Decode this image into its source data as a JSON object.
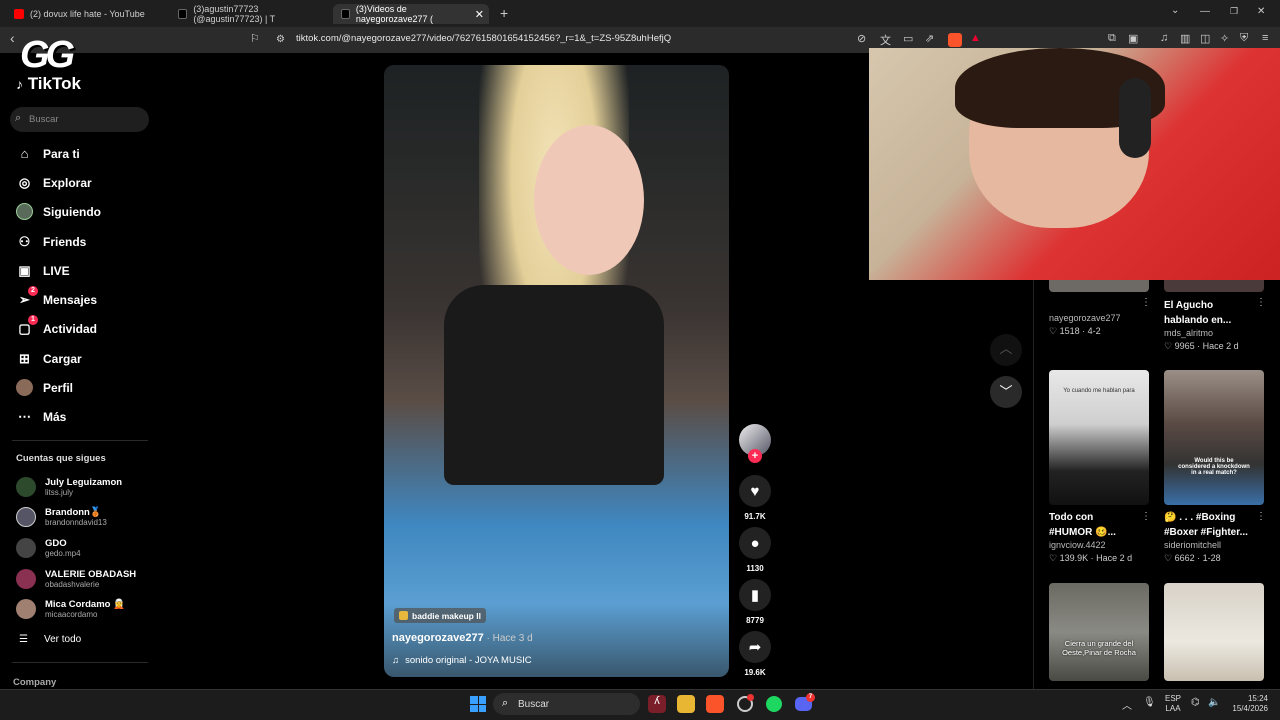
{
  "tabs": [
    {
      "label": "(2) dovux life hate - YouTube",
      "color": "#ff0000"
    },
    {
      "label": "(3)agustin77723 (@agustin77723) | T",
      "color": "#222222"
    },
    {
      "label": "(3)Videos de nayegorozave277 (",
      "color": "#222222"
    }
  ],
  "browser": {
    "url": "tiktok.com/@nayegorozave277/video/7627615801654152456?_r=1&_t=ZS-95Z8uhHefjQ"
  },
  "logo": {
    "watermark": "GG",
    "brand": "TikTok"
  },
  "sidebar": {
    "search_placeholder": "Buscar",
    "nav": [
      {
        "label": "Para ti",
        "icon": "home-icon"
      },
      {
        "label": "Explorar",
        "icon": "compass-icon"
      },
      {
        "label": "Siguiendo",
        "icon": "following-avatar"
      },
      {
        "label": "Friends",
        "icon": "friends-icon"
      },
      {
        "label": "LIVE",
        "icon": "live-icon"
      },
      {
        "label": "Mensajes",
        "icon": "send-icon",
        "badge": "2"
      },
      {
        "label": "Actividad",
        "icon": "activity-icon",
        "badge": "1"
      },
      {
        "label": "Cargar",
        "icon": "upload-icon"
      },
      {
        "label": "Perfil",
        "icon": "profile-avatar"
      },
      {
        "label": "Más",
        "icon": "more-icon"
      }
    ],
    "following_title": "Cuentas que sigues",
    "accounts": [
      {
        "name": "July Leguizamon",
        "handle": "litss.july"
      },
      {
        "name": "Brandonn🥉",
        "handle": "brandonndavid13"
      },
      {
        "name": "GDO",
        "handle": "gedo.mp4"
      },
      {
        "name": "VALERIE OBADASH",
        "handle": "obadashvalerie"
      },
      {
        "name": "Mica Cordamo 🧝",
        "handle": "micaacordamo"
      }
    ],
    "see_all": "Ver todo",
    "company": "Company"
  },
  "video": {
    "effect": "baddie makeup ll",
    "author": "nayegorozave277",
    "time": "Hace 3 d",
    "sound": "sonido original - JOYA MUSIC",
    "likes": "91.7K",
    "comments": "1130",
    "saves": "8779",
    "shares": "19.6K"
  },
  "related": [
    {
      "title": "",
      "user": "nayegorozave277",
      "stats": "1518 · 4-2"
    },
    {
      "title": "El Agucho hablando en...",
      "user": "mds_alritmo",
      "stats": "9965 · Hace 2 d"
    },
    {
      "title": "Todo con #HUMOR 🥴...",
      "user": "ignvciow.4422",
      "stats": "139.9K · Hace 2 d",
      "thumb_text": "Yo cuando me hablan para"
    },
    {
      "title": "🤔 . . . #Boxing #Boxer #Fighter...",
      "user": "sideriomitchell",
      "stats": "6662 · 1-28",
      "thumb_text": "Would this be considered a knockdown in a real match?"
    },
    {
      "title": "",
      "user": "",
      "stats": "",
      "thumb_text": "Cierra un grande del Oeste,Pinar de Rocha"
    },
    {
      "title": "",
      "user": "",
      "stats": "",
      "thumb_text": ""
    }
  ],
  "taskbar": {
    "search": "Buscar",
    "lang1": "ESP",
    "lang2": "LAA",
    "time": "15:24",
    "date": "15/4/2026",
    "discord_badge": "7"
  }
}
